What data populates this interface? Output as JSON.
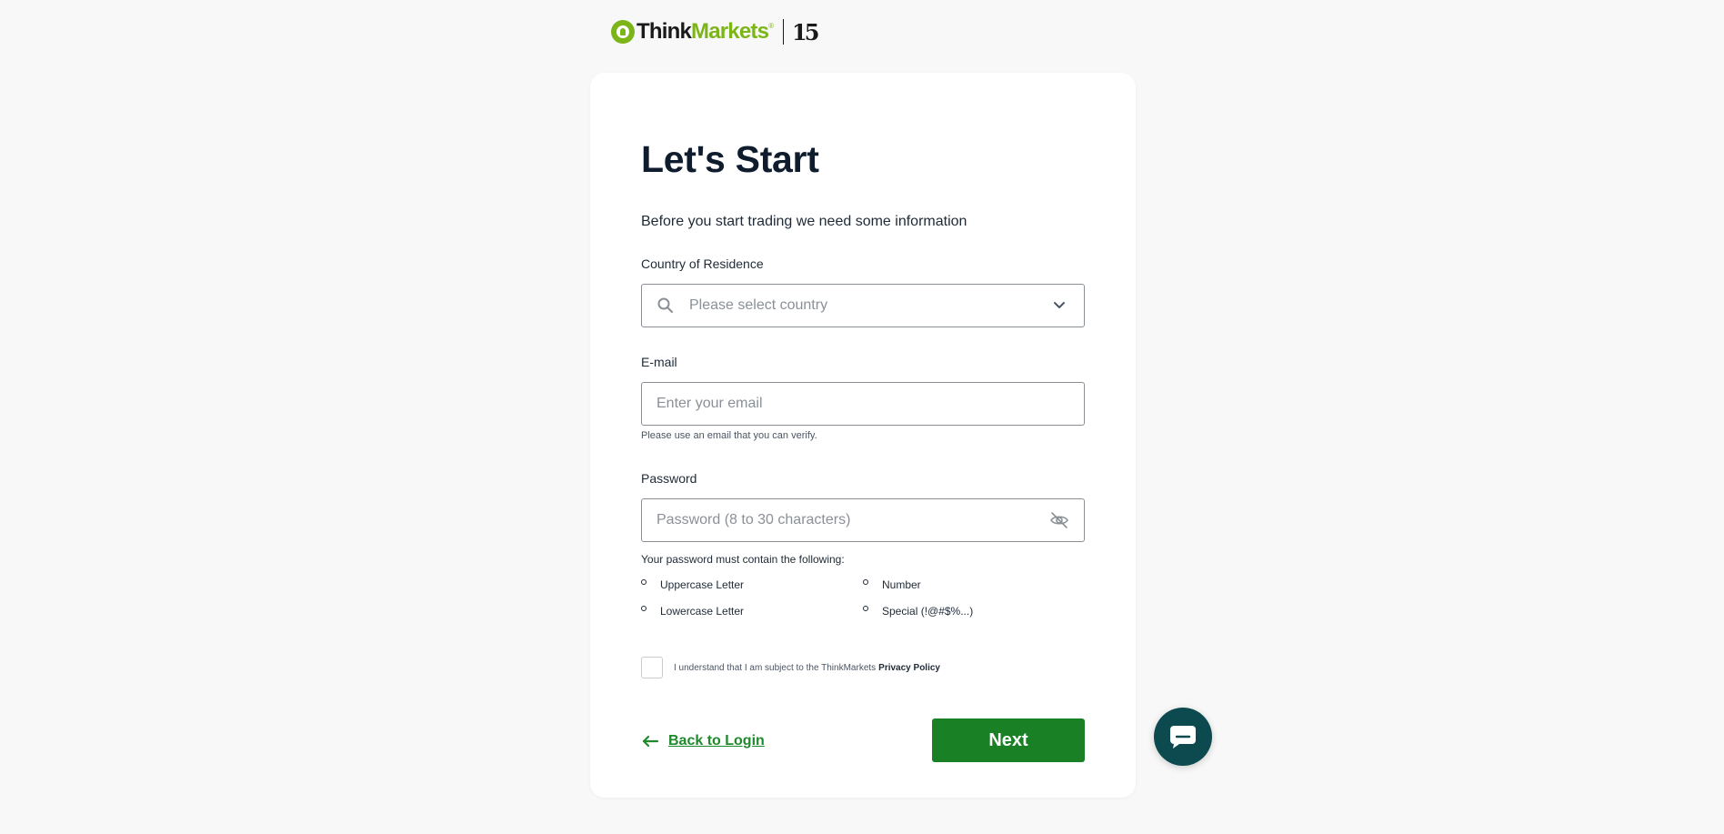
{
  "logo": {
    "think": "Think",
    "markets": "Markets",
    "registered": "®",
    "anniversary": "15"
  },
  "form": {
    "title": "Let's Start",
    "subtitle": "Before you start trading we need some information",
    "country": {
      "label": "Country of Residence",
      "placeholder": "Please select country",
      "icon_left": "search-icon",
      "icon_right": "chevron-down-icon"
    },
    "email": {
      "label": "E-mail",
      "placeholder": "Enter your email",
      "help": "Please use an email that you can verify."
    },
    "password": {
      "label": "Password",
      "placeholder": "Password (8 to 30 characters)",
      "icon_right": "eye-off-icon",
      "requirements_title": "Your password must contain the following:",
      "requirements": [
        "Uppercase Letter",
        "Number",
        "Lowercase Letter",
        "Special (!@#$%...)"
      ]
    },
    "consent": {
      "text": "I understand that I am subject to the ThinkMarkets",
      "link": "Privacy Policy",
      "checked": false
    },
    "back_label": "Back to Login",
    "next_label": "Next"
  },
  "colors": {
    "brand_green": "#7cb518",
    "button_green": "#198025",
    "link_green": "#1e8a2c",
    "chat_teal": "#0d4a4f"
  },
  "chat": {
    "icon": "chat-bubble-icon"
  }
}
